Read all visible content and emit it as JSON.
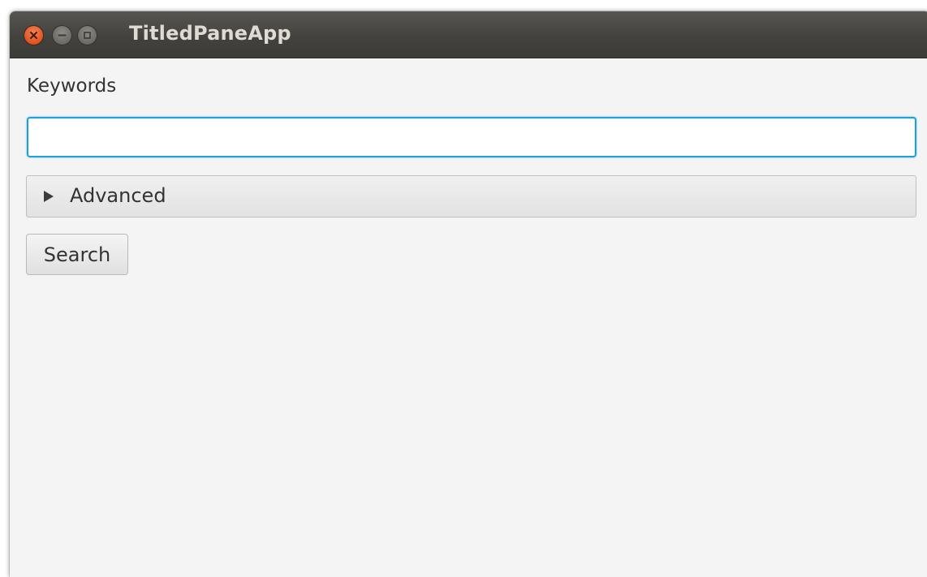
{
  "window": {
    "title": "TitledPaneApp"
  },
  "form": {
    "keywords_label": "Keywords",
    "keywords_value": "",
    "advanced_pane": {
      "title": "Advanced",
      "expanded": false
    },
    "search_label": "Search"
  },
  "colors": {
    "titlebar": "#3c3b37",
    "close_button": "#e2531f",
    "focus_accent": "#1da1d6",
    "content_background": "#f4f4f4"
  }
}
